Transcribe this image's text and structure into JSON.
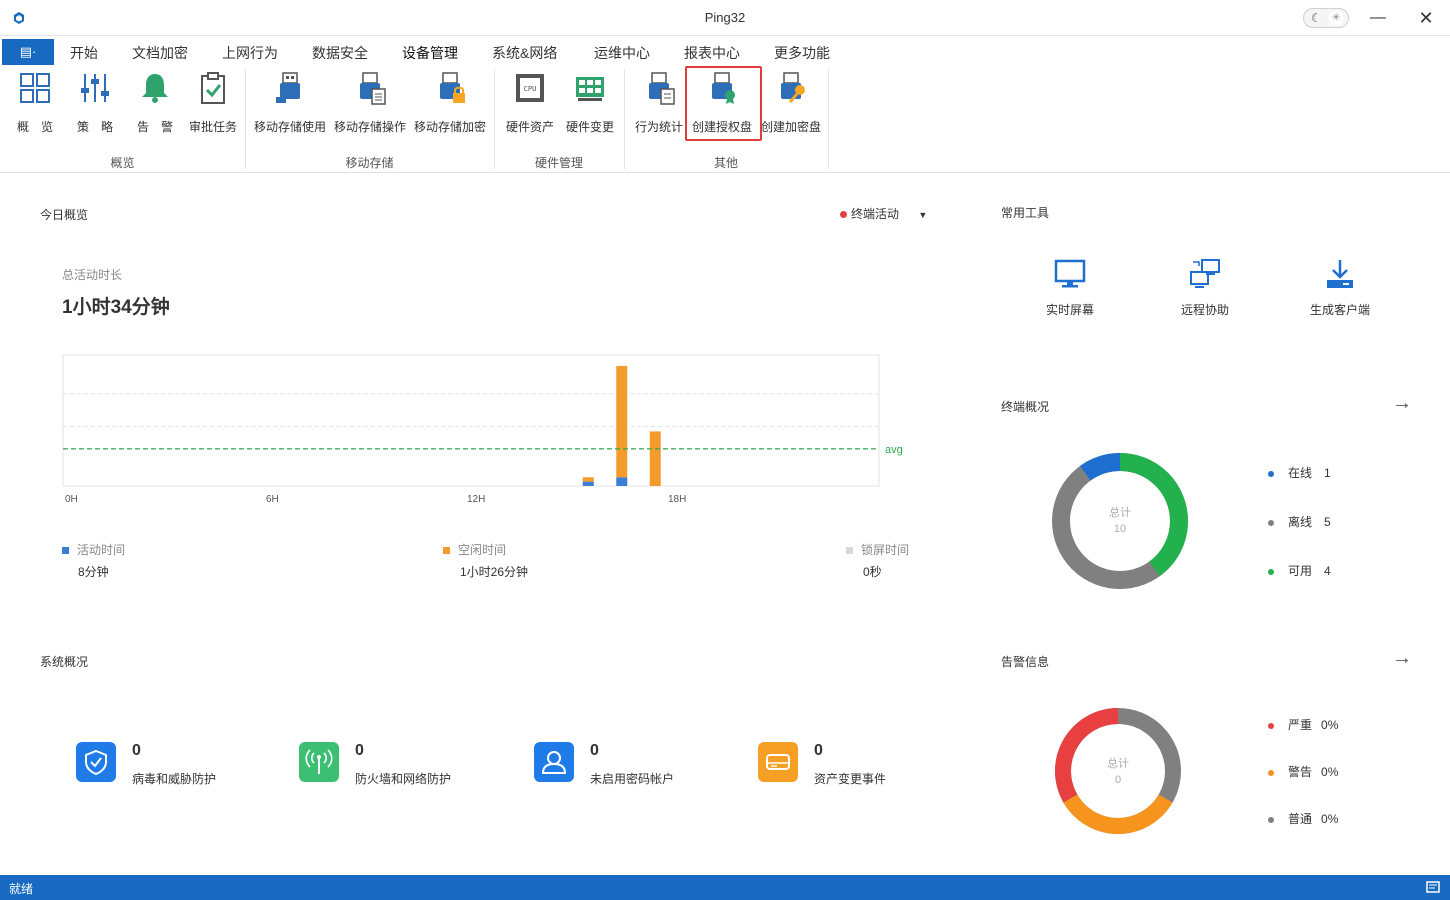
{
  "window": {
    "title": "Ping32"
  },
  "menu": {
    "file_label": "▤·",
    "tabs": [
      {
        "label": "开始"
      },
      {
        "label": "文档加密"
      },
      {
        "label": "上网行为"
      },
      {
        "label": "数据安全"
      },
      {
        "label": "设备管理",
        "active": true
      },
      {
        "label": "系统&网络"
      },
      {
        "label": "运维中心"
      },
      {
        "label": "报表中心"
      },
      {
        "label": "更多功能"
      }
    ]
  },
  "ribbon": {
    "buttons": [
      {
        "label": "概　览",
        "icon": "grid-icon"
      },
      {
        "label": "策　略",
        "icon": "sliders-icon"
      },
      {
        "label": "告　警",
        "icon": "bell-icon"
      },
      {
        "label": "审批任务",
        "icon": "clipboard-check-icon"
      },
      {
        "label": "移动存储使用",
        "icon": "usb-icon"
      },
      {
        "label": "移动存储操作",
        "icon": "usb-doc-icon"
      },
      {
        "label": "移动存储加密",
        "icon": "usb-lock-icon"
      },
      {
        "label": "硬件资产",
        "icon": "cpu-icon"
      },
      {
        "label": "硬件变更",
        "icon": "hardware-change-icon"
      },
      {
        "label": "行为统计",
        "icon": "usb-stats-icon"
      },
      {
        "label": "创建授权盘",
        "icon": "usb-badge-icon"
      },
      {
        "label": "创建加密盘",
        "icon": "usb-key-icon"
      }
    ],
    "groups": [
      {
        "label": "概览"
      },
      {
        "label": "移动存储"
      },
      {
        "label": "硬件管理"
      },
      {
        "label": "其他"
      }
    ]
  },
  "today": {
    "title": "今日概览",
    "filter_label": "终端活动",
    "total_label": "总活动时长",
    "total_value": "1小时34分钟",
    "legend": [
      {
        "label": "活动时间",
        "value": "8分钟",
        "color": "#3a7fd5"
      },
      {
        "label": "空闲时间",
        "value": "1小时26分钟",
        "color": "#f39b2c"
      },
      {
        "label": "锁屏时间",
        "value": "0秒",
        "color": "#d9d9d9"
      }
    ]
  },
  "chart_data": {
    "type": "bar",
    "stacked": true,
    "x_ticks": [
      "0H",
      "6H",
      "12H",
      "18H"
    ],
    "x_range_hours": [
      0,
      24
    ],
    "avg_label": "avg",
    "series": [
      {
        "name": "活动时间",
        "color": "#3a7fd5",
        "points": [
          {
            "hour": 15.5,
            "value": 2
          },
          {
            "hour": 16.5,
            "value": 4
          }
        ]
      },
      {
        "name": "空闲时间",
        "color": "#f39b2c",
        "points": [
          {
            "hour": 15.5,
            "value": 2
          },
          {
            "hour": 16.5,
            "value": 51
          },
          {
            "hour": 17.5,
            "value": 25
          }
        ]
      }
    ],
    "avg_value": 17,
    "y_max": 60,
    "grid": true
  },
  "tools": {
    "title": "常用工具",
    "items": [
      {
        "label": "实时屏幕",
        "icon": "monitor-icon"
      },
      {
        "label": "远程协助",
        "icon": "remote-assist-icon"
      },
      {
        "label": "生成客户端",
        "icon": "download-client-icon"
      }
    ]
  },
  "terminals": {
    "title": "终端概况",
    "center_label": "总计",
    "center_value": "10",
    "items": [
      {
        "label": "在线",
        "value": "1",
        "color": "#1e6fd0"
      },
      {
        "label": "离线",
        "value": "5",
        "color": "#808080"
      },
      {
        "label": "可用",
        "value": "4",
        "color": "#22b14c"
      }
    ]
  },
  "system": {
    "title": "系统概况",
    "items": [
      {
        "count": "0",
        "label": "病毒和威胁防护",
        "color": "#1e7be8",
        "icon": "shield-icon"
      },
      {
        "count": "0",
        "label": "防火墙和网络防护",
        "color": "#3dbf73",
        "icon": "antenna-icon"
      },
      {
        "count": "0",
        "label": "未启用密码帐户",
        "color": "#1e7be8",
        "icon": "user-icon"
      },
      {
        "count": "0",
        "label": "资产变更事件",
        "color": "#f5a024",
        "icon": "drive-icon"
      }
    ]
  },
  "alerts": {
    "title": "告警信息",
    "center_label": "总计",
    "center_value": "0",
    "items": [
      {
        "label": "严重",
        "value": "0%",
        "color": "#e84040"
      },
      {
        "label": "警告",
        "value": "0%",
        "color": "#f7941d"
      },
      {
        "label": "普通",
        "value": "0%",
        "color": "#808080"
      }
    ]
  },
  "status": {
    "text": "就绪"
  }
}
